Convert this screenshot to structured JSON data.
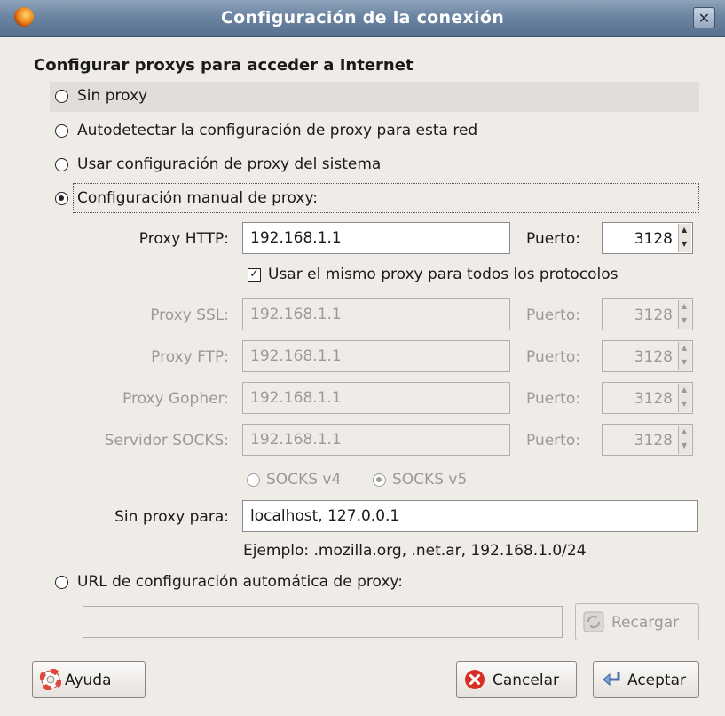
{
  "window": {
    "title": "Configuración de la conexión",
    "close_glyph": "✕"
  },
  "heading": "Configurar proxys para acceder a Internet",
  "modes": {
    "none": "Sin proxy",
    "autodetect": "Autodetectar la configuración de proxy para esta red",
    "system": "Usar configuración de proxy del sistema",
    "manual": "Configuración manual de proxy:",
    "auto_url": "URL de configuración automática de proxy:",
    "selected": "manual"
  },
  "manual": {
    "http": {
      "label": "Proxy HTTP:",
      "host": "192.168.1.1",
      "port_label": "Puerto:",
      "port": "3128"
    },
    "same_proxy": {
      "label": "Usar el mismo proxy para todos los protocolos",
      "checked": true,
      "glyph": "✓"
    },
    "ssl": {
      "label": "Proxy SSL:",
      "host": "192.168.1.1",
      "port_label": "Puerto:",
      "port": "3128"
    },
    "ftp": {
      "label": "Proxy FTP:",
      "host": "192.168.1.1",
      "port_label": "Puerto:",
      "port": "3128"
    },
    "gopher": {
      "label": "Proxy Gopher:",
      "host": "192.168.1.1",
      "port_label": "Puerto:",
      "port": "3128"
    },
    "socks": {
      "label": "Servidor SOCKS:",
      "host": "192.168.1.1",
      "port_label": "Puerto:",
      "port": "3128"
    },
    "socks_v4": "SOCKS v4",
    "socks_v5": "SOCKS v5",
    "no_proxy_label": "Sin proxy para:",
    "no_proxy_value": "localhost, 127.0.0.1",
    "example": "Ejemplo: .mozilla.org, .net.ar, 192.168.1.0/24"
  },
  "auto_url_value": "",
  "buttons": {
    "reload": "Recargar",
    "help": "Ayuda",
    "cancel": "Cancelar",
    "ok": "Aceptar"
  },
  "icons": {
    "app": "firefox-icon",
    "help": "lifebuoy-icon",
    "cancel": "cancel-icon",
    "ok": "return-arrow-icon",
    "reload": "reload-icon"
  },
  "colors": {
    "titlebar": "#6b84a1",
    "dialog_bg": "#efebe7",
    "cancel_red": "#d93025"
  }
}
